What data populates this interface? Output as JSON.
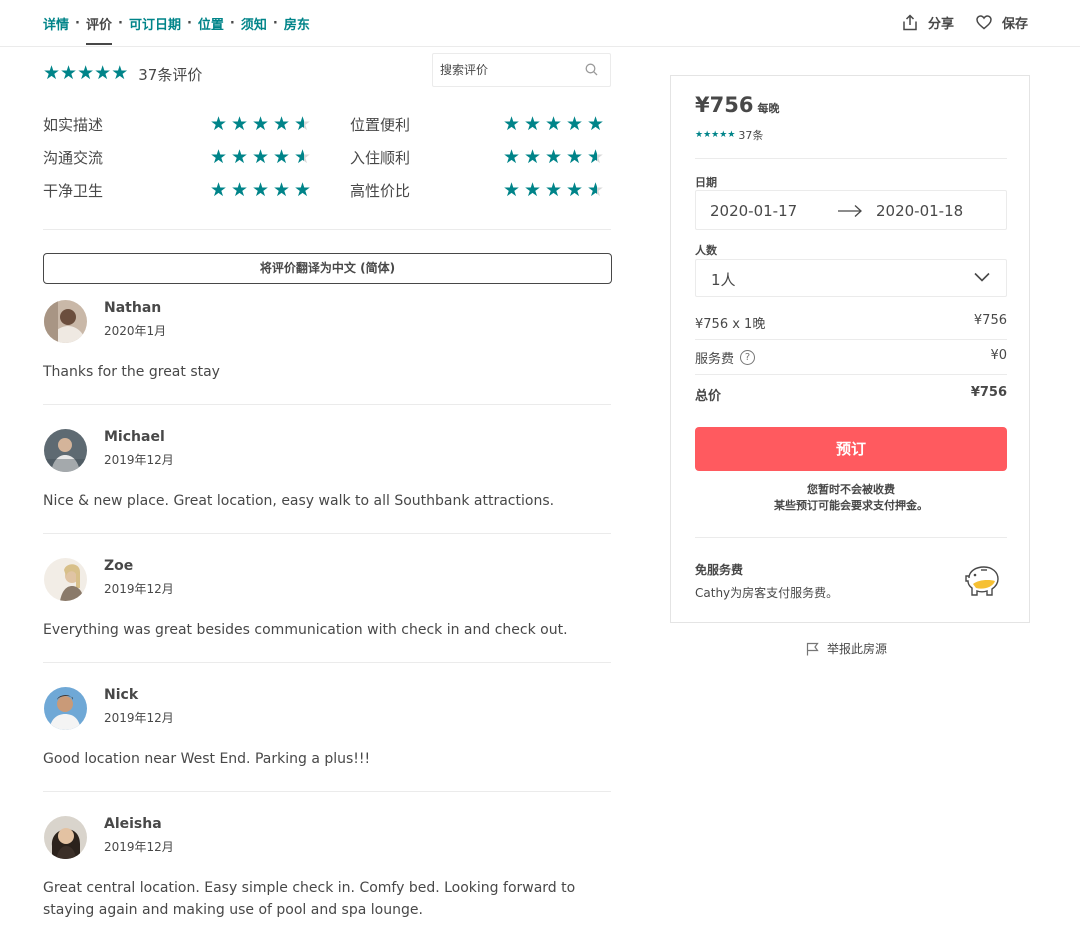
{
  "nav": {
    "links": [
      "详情",
      "评价",
      "可订日期",
      "位置",
      "须知",
      "房东"
    ],
    "separator": "·",
    "active_index": 1,
    "share_label": "分享",
    "save_label": "保存",
    "share_icon": "share-icon",
    "save_icon": "heart-icon"
  },
  "reviews_header": {
    "overall_stars": 5,
    "count_label": "37条评价",
    "search_placeholder": "搜索评价",
    "search_icon": "search-icon"
  },
  "categories": [
    {
      "label": "如实描述",
      "rating": 4.5
    },
    {
      "label": "位置便利",
      "rating": 5
    },
    {
      "label": "沟通交流",
      "rating": 4.5
    },
    {
      "label": "入住顺利",
      "rating": 4.5
    },
    {
      "label": "干净卫生",
      "rating": 5
    },
    {
      "label": "高性价比",
      "rating": 4.5
    }
  ],
  "translate_button": "将评价翻译为中文 (简体)",
  "reviews": [
    {
      "name": "Nathan",
      "date": "2020年1月",
      "text": "Thanks for the great stay"
    },
    {
      "name": "Michael",
      "date": "2019年12月",
      "text": "Nice & new place. Great location, easy walk to all Southbank attractions."
    },
    {
      "name": "Zoe",
      "date": "2019年12月",
      "text": "Everything was great besides communication with check in and check out."
    },
    {
      "name": "Nick",
      "date": "2019年12月",
      "text": "Good location near West End. Parking a plus!!!"
    },
    {
      "name": "Aleisha",
      "date": "2019年12月",
      "text": "Great central location. Easy simple check in. Comfy bed. Looking forward to staying again and making use of pool and spa lounge."
    }
  ],
  "booking": {
    "price": "¥756",
    "per_night": "每晚",
    "stars": 5,
    "review_count": "37条",
    "dates_label": "日期",
    "checkin": "2020-01-17",
    "checkout": "2020-01-18",
    "guests_label": "人数",
    "guests_value": "1人",
    "line_item_label": "¥756 x 1晚",
    "line_item_value": "¥756",
    "service_fee_label": "服务费",
    "service_fee_value": "¥0",
    "total_label": "总价",
    "total_value": "¥756",
    "book_button": "预订",
    "no_charge_line1": "您暂时不会被收费",
    "no_charge_line2": "某些预订可能会要求支付押金。",
    "free_title": "免服务费",
    "free_desc": "Cathy为房客支付服务费。",
    "accent_color": "#ff5a5f"
  },
  "report_label": "举报此房源",
  "colors": {
    "teal": "#008489",
    "text": "#484848",
    "book": "#ff5a5f"
  }
}
